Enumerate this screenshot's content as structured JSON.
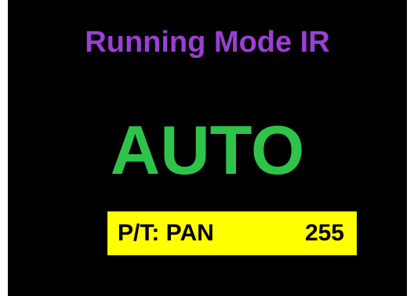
{
  "display": {
    "title": "Running Mode IR",
    "mode": "AUTO",
    "status_label": "P/T: PAN",
    "status_value": "255"
  },
  "colors": {
    "background": "#000000",
    "title": "#9b3fd4",
    "mode": "#2ec44a",
    "status_bar": "#ffff00",
    "status_text": "#000000"
  }
}
